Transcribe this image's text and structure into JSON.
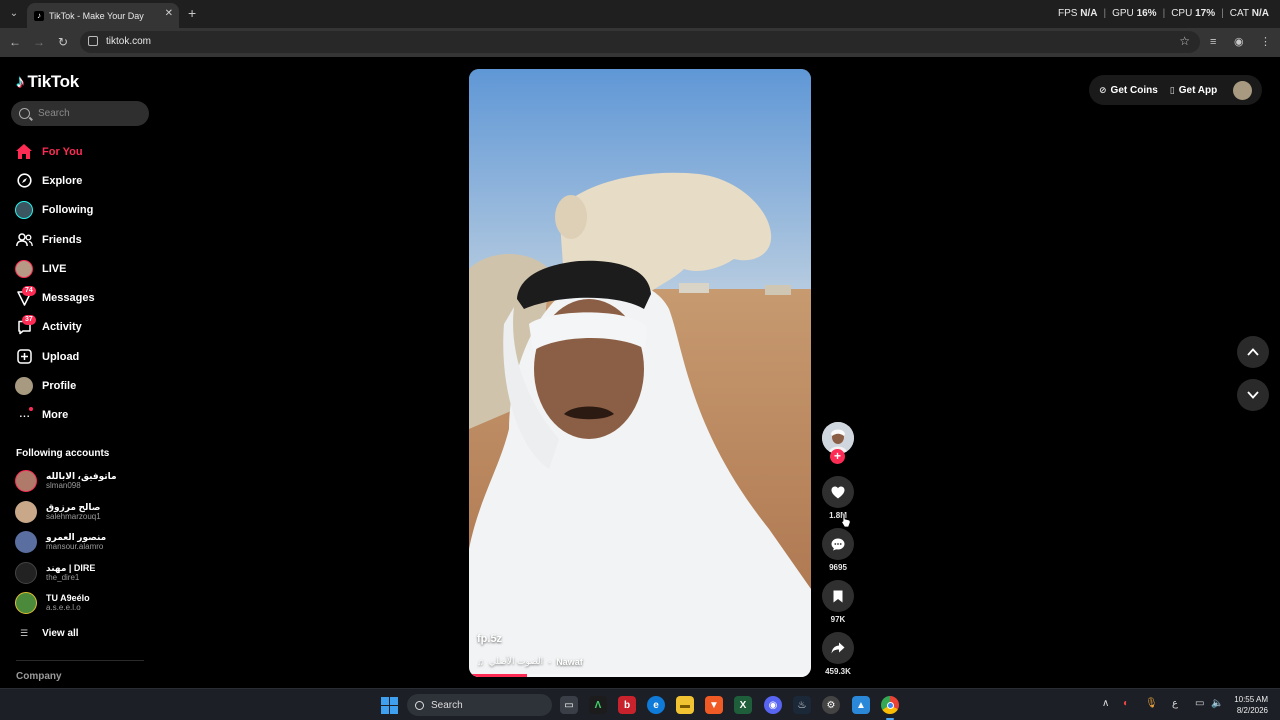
{
  "browser": {
    "tab_title": "TikTok - Make Your Day",
    "url": "tiktok.com",
    "perf": {
      "fps_label": "FPS",
      "fps_value": "N/A",
      "gpu_label": "GPU",
      "gpu_value": "16%",
      "cpu_label": "CPU",
      "cpu_value": "17%",
      "cat_label": "CAT",
      "cat_value": "N/A"
    }
  },
  "sidebar": {
    "logo": "TikTok",
    "search_placeholder": "Search",
    "nav": [
      {
        "label": "For You",
        "icon": "home-icon",
        "active": true
      },
      {
        "label": "Explore",
        "icon": "compass-icon"
      },
      {
        "label": "Following",
        "icon": "following-avatar"
      },
      {
        "label": "Friends",
        "icon": "friends-icon"
      },
      {
        "label": "LIVE",
        "icon": "live-avatar"
      },
      {
        "label": "Messages",
        "icon": "messages-icon",
        "badge": "74"
      },
      {
        "label": "Activity",
        "icon": "activity-icon",
        "badge": "37"
      },
      {
        "label": "Upload",
        "icon": "upload-icon"
      },
      {
        "label": "Profile",
        "icon": "profile-avatar"
      },
      {
        "label": "More",
        "icon": "more-icon"
      }
    ],
    "following_title": "Following accounts",
    "accounts": [
      {
        "name": "ماتوفيق، الابالله",
        "handle": "slman098",
        "color": "#b07a6a"
      },
      {
        "name": "صالح مرزوق",
        "handle": "salehmarzouq1",
        "color": "#c9a88a"
      },
      {
        "name": "منصور العمرو",
        "handle": "mansour.alamro",
        "color": "#5a6fa0"
      },
      {
        "name": "مهند | DIRE",
        "handle": "the_dire1",
        "color": "#222222"
      },
      {
        "name": "TU A9eélo",
        "handle": "a.s.e.e.l.o",
        "color": "#4a8a3a"
      }
    ],
    "view_all": "View all",
    "company": "Company"
  },
  "video": {
    "username": "fp.5z",
    "music_title": "الصوت الأصلي",
    "music_sep": " - ",
    "music_artist": "Nawaf",
    "progress": 0.17
  },
  "actions": {
    "likes": "1.8M",
    "comments": "9695",
    "saves": "97K",
    "shares": "459.3K"
  },
  "topbar": {
    "get_coins": "Get Coins",
    "get_app": "Get App"
  },
  "taskbar": {
    "search_label": "Search",
    "time": "10:55 AM",
    "date": "8/2/2026",
    "lang": "ع"
  },
  "colors": {
    "accent": "#fe2c55",
    "background": "#000000"
  }
}
